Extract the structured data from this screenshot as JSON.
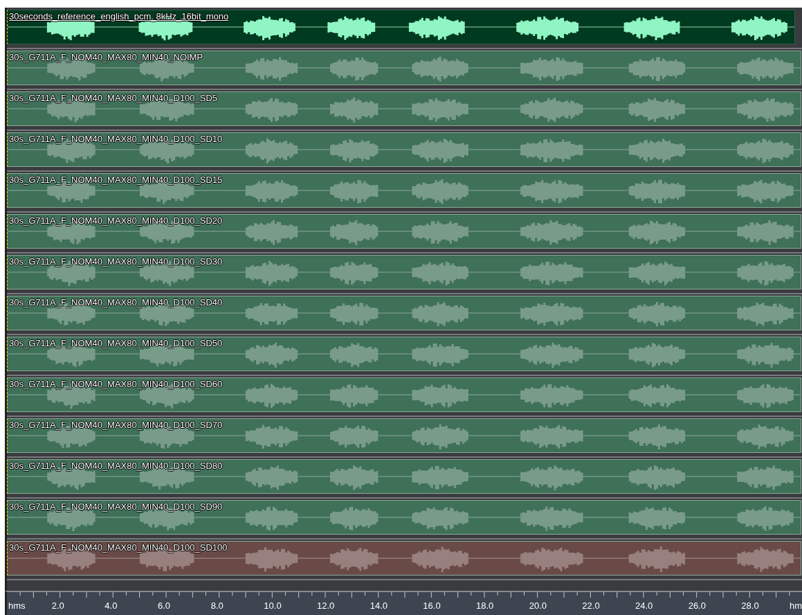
{
  "tracks": [
    {
      "title": "30seconds_reference_english_pcm_8kHz_16bit_mono",
      "selected": true,
      "color": "#003a20"
    },
    {
      "title": "30s_G711A_F_NOM40_MAX80_MIN40_NOIMP",
      "selected": false,
      "color": "#3f7058"
    },
    {
      "title": "30s_G711A_F_NOM40_MAX80_MIN40_D100_SD5",
      "selected": false,
      "color": "#3f7058"
    },
    {
      "title": "30s_G711A_F_NOM40_MAX80_MIN40_D100_SD10",
      "selected": false,
      "color": "#3f7058"
    },
    {
      "title": "30s_G711A_F_NOM40_MAX80_MIN40_D100_SD15",
      "selected": false,
      "color": "#3f7058"
    },
    {
      "title": "30s_G711A_F_NOM40_MAX80_MIN40_D100_SD20",
      "selected": false,
      "color": "#3f7058"
    },
    {
      "title": "30s_G711A_F_NOM40_MAX80_MIN40_D100_SD30",
      "selected": false,
      "color": "#3f7058"
    },
    {
      "title": "30s_G711A_F_NOM40_MAX80_MIN40_D100_SD40",
      "selected": false,
      "color": "#3f7058"
    },
    {
      "title": "30s_G711A_F_NOM40_MAX80_MIN40_D100_SD50",
      "selected": false,
      "color": "#3f7058"
    },
    {
      "title": "30s_G711A_F_NOM40_MAX80_MIN40_D100_SD60",
      "selected": false,
      "color": "#3f7058"
    },
    {
      "title": "30s_G711A_F_NOM40_MAX80_MIN40_D100_SD70",
      "selected": false,
      "color": "#3f7058"
    },
    {
      "title": "30s_G711A_F_NOM40_MAX80_MIN40_D100_SD80",
      "selected": false,
      "color": "#3f7058"
    },
    {
      "title": "30s_G711A_F_NOM40_MAX80_MIN40_D100_SD90",
      "selected": false,
      "color": "#3f7058"
    },
    {
      "title": "30s_G711A_F_NOM40_MAX80_MIN40_D100_SD100",
      "selected": false,
      "color": "#6a4a47"
    }
  ],
  "ruler": {
    "unit_start": "hms",
    "labels": [
      "2.0",
      "4.0",
      "6.0",
      "8.0",
      "10.0",
      "12.0",
      "14.0",
      "16.0",
      "18.0",
      "20.0",
      "22.0",
      "24.0",
      "26.0",
      "28.0"
    ],
    "unit_end": "hm"
  }
}
